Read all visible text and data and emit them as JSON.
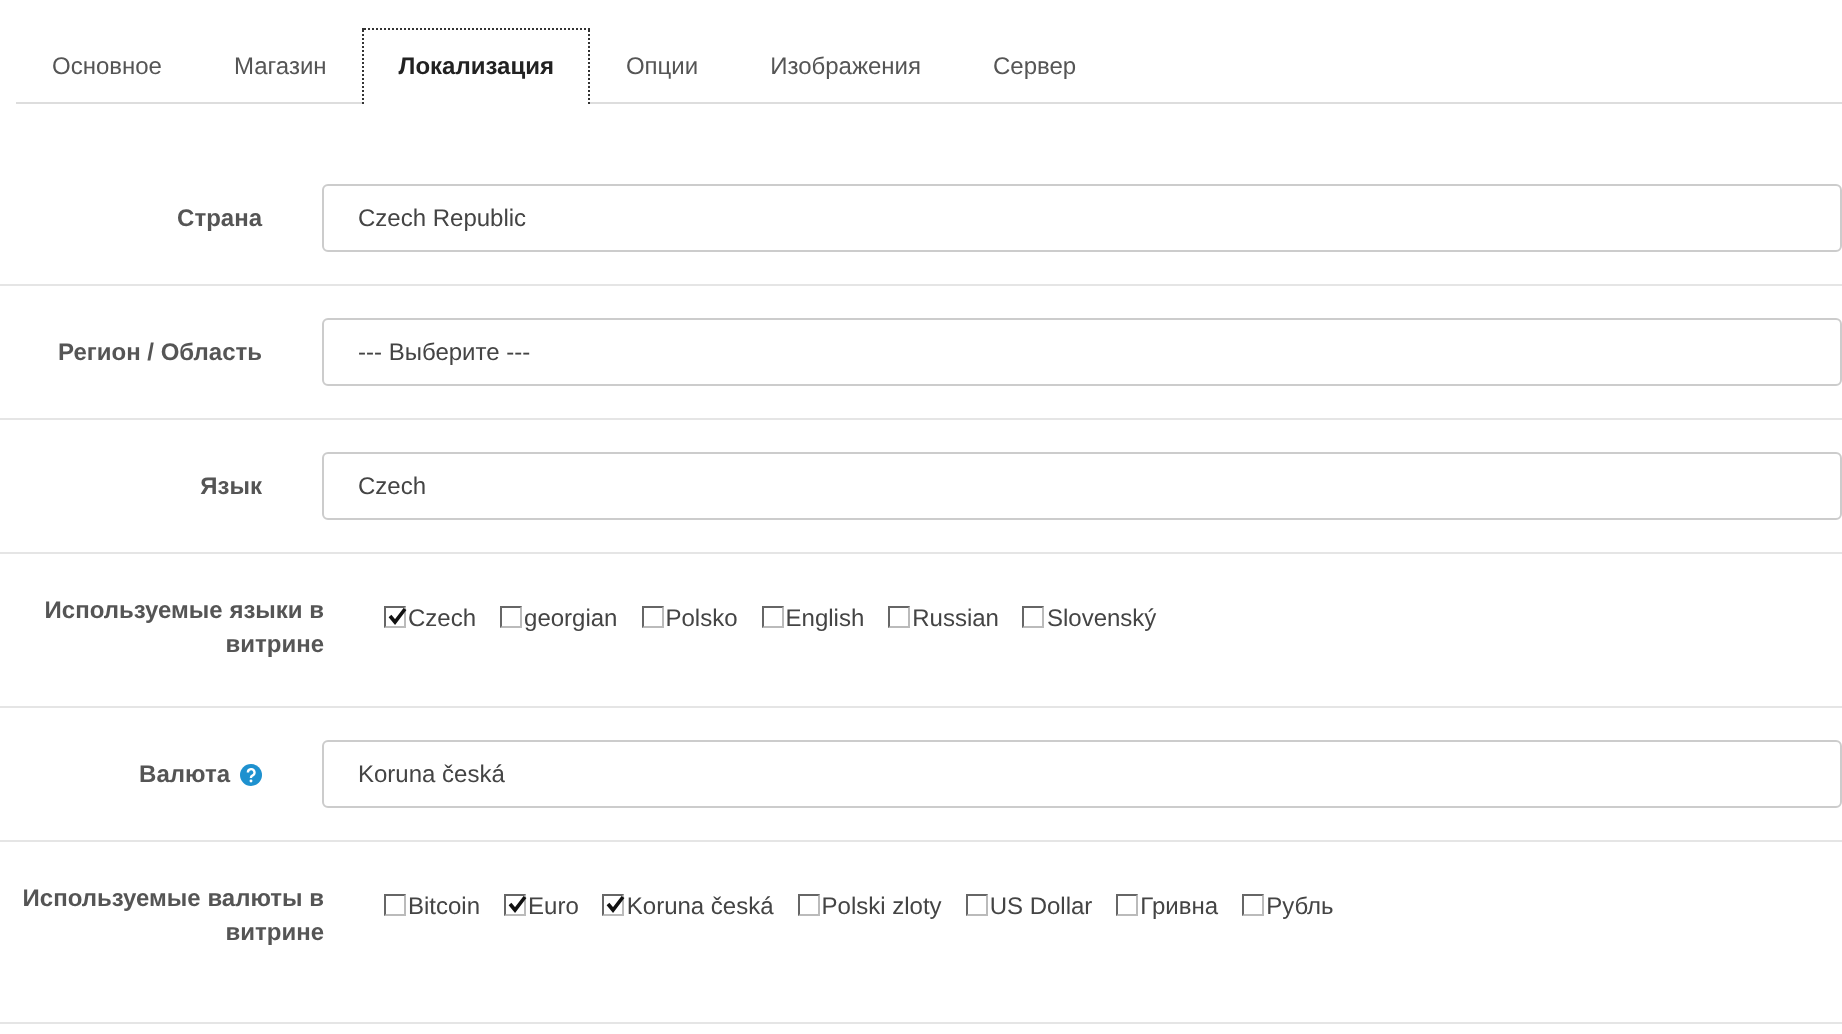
{
  "tabs": [
    {
      "label": "Основное",
      "selected": false
    },
    {
      "label": "Магазин",
      "selected": false
    },
    {
      "label": "Локализация",
      "selected": true
    },
    {
      "label": "Опции",
      "selected": false
    },
    {
      "label": "Изображения",
      "selected": false
    },
    {
      "label": "Сервер",
      "selected": false
    }
  ],
  "rows": [
    {
      "kind": "select",
      "label": "Страна",
      "value": "Czech Republic"
    },
    {
      "kind": "select",
      "label": "Регион / Область",
      "value": "--- Выберите ---"
    },
    {
      "kind": "select",
      "label": "Язык",
      "value": "Czech"
    },
    {
      "kind": "checkboxes",
      "label": "Используемые языки в витрине",
      "options": [
        {
          "label": "Czech",
          "checked": true
        },
        {
          "label": "georgian",
          "checked": false
        },
        {
          "label": "Polsko",
          "checked": false
        },
        {
          "label": "English",
          "checked": false
        },
        {
          "label": "Russian",
          "checked": false
        },
        {
          "label": "Slovenský",
          "checked": false
        }
      ]
    },
    {
      "kind": "select",
      "label": "Валюта",
      "help": true,
      "value": "Koruna česká"
    },
    {
      "kind": "checkboxes",
      "label": "Используемые валюты в витрине",
      "options": [
        {
          "label": "Bitcoin",
          "checked": false
        },
        {
          "label": "Euro",
          "checked": true
        },
        {
          "label": "Koruna česká",
          "checked": true
        },
        {
          "label": "Polski zloty",
          "checked": false
        },
        {
          "label": "US Dollar",
          "checked": false
        },
        {
          "label": "Гривна",
          "checked": false
        },
        {
          "label": "Рубль",
          "checked": false
        }
      ]
    }
  ]
}
